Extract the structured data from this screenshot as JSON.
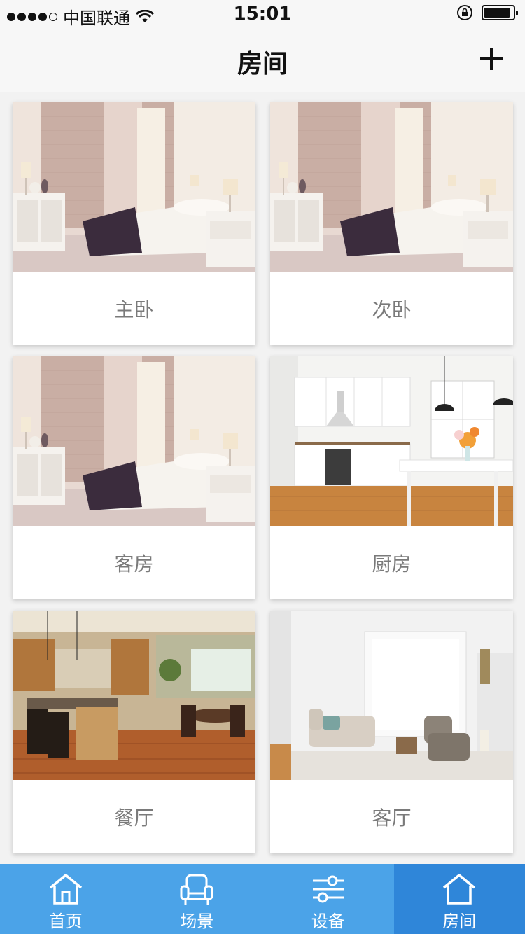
{
  "status_bar": {
    "carrier": "中国联通",
    "time": "15:01"
  },
  "nav": {
    "title": "房间",
    "add_icon": "plus-icon"
  },
  "rooms": [
    {
      "name": "主卧",
      "image": "bedroom-photo"
    },
    {
      "name": "次卧",
      "image": "bedroom-photo"
    },
    {
      "name": "客房",
      "image": "bedroom-photo"
    },
    {
      "name": "厨房",
      "image": "kitchen-photo"
    },
    {
      "name": "餐厅",
      "image": "dining-photo"
    },
    {
      "name": "客厅",
      "image": "living-room-photo"
    }
  ],
  "tabs": [
    {
      "label": "首页",
      "icon": "home-icon"
    },
    {
      "label": "场景",
      "icon": "armchair-icon"
    },
    {
      "label": "设备",
      "icon": "sliders-icon"
    },
    {
      "label": "房间",
      "icon": "house-outline-icon",
      "active": true
    }
  ],
  "colors": {
    "tabbar": "#4ba3e8",
    "tab_active": "#2f86d9",
    "label_text": "#7a7a7a"
  }
}
